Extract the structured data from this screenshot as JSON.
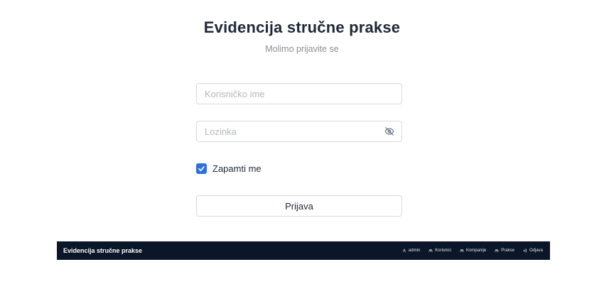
{
  "login": {
    "title": "Evidencija stručne prakse",
    "subtitle": "Molimo prijavite se",
    "username_placeholder": "Korisničko ime",
    "username_value": "",
    "password_placeholder": "Lozinka",
    "password_value": "",
    "remember_label": "Zapamti me",
    "remember_checked": true,
    "submit_label": "Prijava"
  },
  "navbar": {
    "brand": "Evidencija stručne prakse",
    "items": [
      {
        "label": "admin",
        "icon": "user-icon"
      },
      {
        "label": "Korisnici",
        "icon": "users-icon"
      },
      {
        "label": "Kompanije",
        "icon": "users-icon"
      },
      {
        "label": "Prakse",
        "icon": "users-icon"
      },
      {
        "label": "Odjava",
        "icon": "logout-icon"
      }
    ]
  },
  "colors": {
    "accent": "#2f6fe0",
    "navbar_bg": "#0b1628",
    "title_text": "#1f2937",
    "muted_text": "#8a8f98",
    "border": "#d6d9de"
  }
}
